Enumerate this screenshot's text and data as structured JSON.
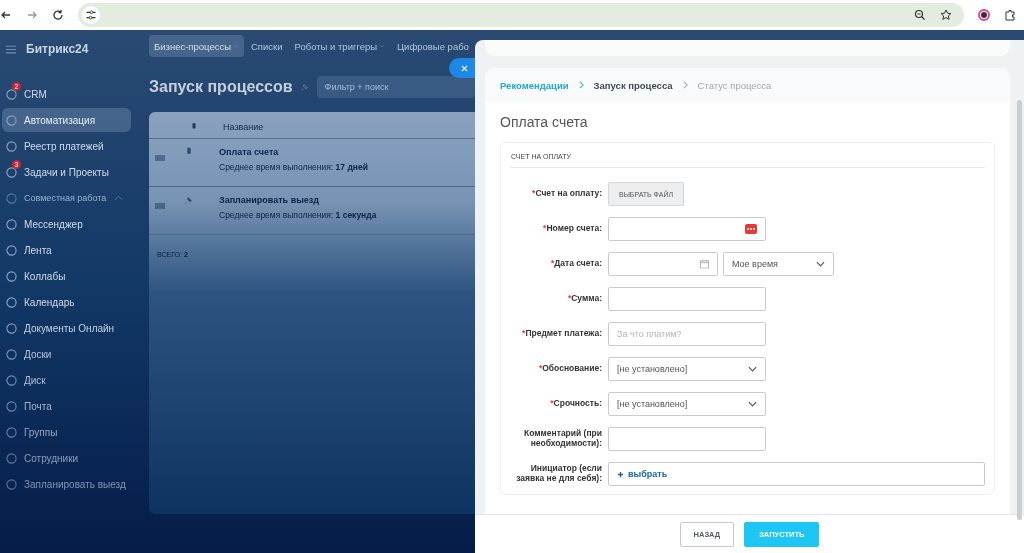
{
  "app": {
    "logo": "Битрикс24",
    "nav": [
      {
        "label": "Бизнес-процессы",
        "selected": true,
        "dropdown": true
      },
      {
        "label": "Списки",
        "selected": false,
        "dropdown": false
      },
      {
        "label": "Роботы и триггеры",
        "selected": false,
        "dropdown": true
      },
      {
        "label": "Цифровые рабо",
        "selected": false,
        "dropdown": false
      }
    ],
    "sidebar": [
      {
        "kind": "item",
        "label": "CRM",
        "badge": "2",
        "selected": false
      },
      {
        "kind": "item",
        "label": "Автоматизация",
        "selected": true
      },
      {
        "kind": "item",
        "label": "Реестр платежей",
        "selected": false
      },
      {
        "kind": "item",
        "label": "Задачи и Проекты",
        "badge": "3",
        "selected": false
      },
      {
        "kind": "group",
        "label": "Совместная работа",
        "expanded": true
      },
      {
        "kind": "item",
        "label": "Мессенджер",
        "selected": false
      },
      {
        "kind": "item",
        "label": "Лента",
        "selected": false
      },
      {
        "kind": "item",
        "label": "Коллабы",
        "selected": false
      },
      {
        "kind": "item",
        "label": "Календарь",
        "selected": false
      },
      {
        "kind": "item",
        "label": "Документы Онлайн",
        "selected": false
      },
      {
        "kind": "item",
        "label": "Доски",
        "selected": false
      },
      {
        "kind": "item",
        "label": "Диск",
        "selected": false
      },
      {
        "kind": "item",
        "label": "Почта",
        "selected": false
      },
      {
        "kind": "item",
        "label": "Группы",
        "selected": false
      },
      {
        "kind": "item",
        "label": "Сотрудники",
        "selected": false
      },
      {
        "kind": "item",
        "label": "Запланировать выезд",
        "selected": false
      }
    ],
    "page_title": "Запуск процессов",
    "filter": {
      "placeholder": "Фильтр + поиск"
    },
    "table": {
      "columns": [
        "Название"
      ],
      "rows": [
        {
          "title": "Оплата счета",
          "subtitle": "Среднее время выполнения: **17 дней**",
          "pinned": true
        },
        {
          "title": "Запланировать выезд",
          "subtitle": "Среднее время выполнения: **1 секунда**",
          "pinned": false
        }
      ],
      "total": "ВСЕГО: **2**"
    }
  },
  "panel": {
    "breadcrumbs": [
      {
        "label": "Рекомендации",
        "done": true,
        "selected": false
      },
      {
        "label": "Запуск процесса",
        "done": false,
        "selected": true
      },
      {
        "label": "Статус процесса",
        "done": false,
        "selected": false
      }
    ],
    "title": "Оплата счета",
    "section": "СЧЕТ НА ОПЛАТУ",
    "fields": [
      {
        "kind": "file",
        "marker": "*",
        "label": "Счет на оплату:",
        "button": "ВЫБРАТЬ ФАЙЛ"
      },
      {
        "kind": "text",
        "marker": "*",
        "label": "Номер счета:",
        "badge_icon": true
      },
      {
        "kind": "date",
        "marker": "*",
        "label": "Дата счета:",
        "time_zone": "Мое время"
      },
      {
        "kind": "text",
        "marker": "*",
        "label": "Сумма:"
      },
      {
        "kind": "text",
        "marker": "*",
        "label": "Предмет платежа:",
        "placeholder": "За что платим?"
      },
      {
        "kind": "select",
        "marker": "*",
        "label": "Обоснование:",
        "value": "[не установлено]"
      },
      {
        "kind": "select",
        "marker": "*",
        "label": "Срочность:",
        "value": "[не установлено]"
      },
      {
        "kind": "text",
        "label": "Комментарий (при необходимости):"
      },
      {
        "kind": "user",
        "label": "Инициатор (если заявка не для себя):",
        "action": "выбрать"
      }
    ],
    "buttons": [
      {
        "label": "НАЗАД",
        "kind": "secondary"
      },
      {
        "label": "ЗАПУСТИТЬ",
        "kind": "primary"
      }
    ]
  }
}
